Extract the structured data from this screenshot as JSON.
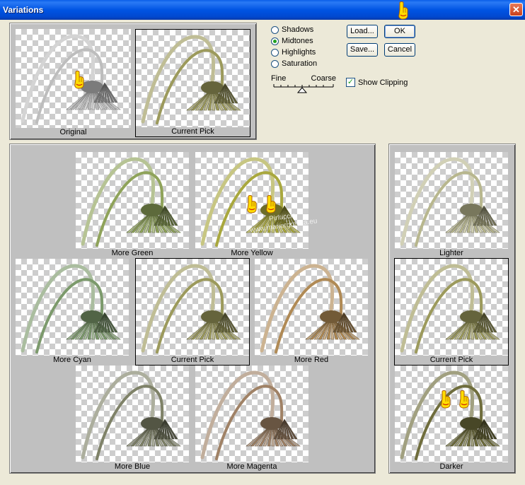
{
  "window": {
    "title": "Variations",
    "close_glyph": "✕"
  },
  "modes": [
    {
      "label": "Shadows",
      "checked": false
    },
    {
      "label": "Midtones",
      "checked": true
    },
    {
      "label": "Highlights",
      "checked": false
    },
    {
      "label": "Saturation",
      "checked": false
    }
  ],
  "slider": {
    "fine_label": "Fine",
    "coarse_label": "Coarse"
  },
  "buttons": {
    "load": "Load...",
    "ok": "OK",
    "save": "Save...",
    "cancel": "Cancel"
  },
  "show_clipping": {
    "label": "Show Clipping",
    "checked": true
  },
  "top": {
    "original": "Original",
    "current": "Current Pick"
  },
  "color_grid": {
    "more_green": "More Green",
    "more_yellow": "More Yellow",
    "more_cyan": "More Cyan",
    "current": "Current Pick",
    "more_red": "More Red",
    "more_blue": "More Blue",
    "more_magenta": "More Magenta"
  },
  "brightness": {
    "lighter": "Lighter",
    "current": "Current Pick",
    "darker": "Darker"
  },
  "watermark": {
    "line1": "Pinuccia",
    "line2": "www.mariergrafica.eu"
  },
  "colors": {
    "original": "#bdbdbd",
    "current": "#9c9a5c",
    "more_green": "#8fa35a",
    "more_yellow": "#a9a83e",
    "more_cyan": "#7c9a6c",
    "more_red": "#b08a55",
    "more_blue": "#7f8268",
    "more_magenta": "#a08266",
    "lighter": "#b8b78e",
    "darker": "#6f6d3c"
  }
}
